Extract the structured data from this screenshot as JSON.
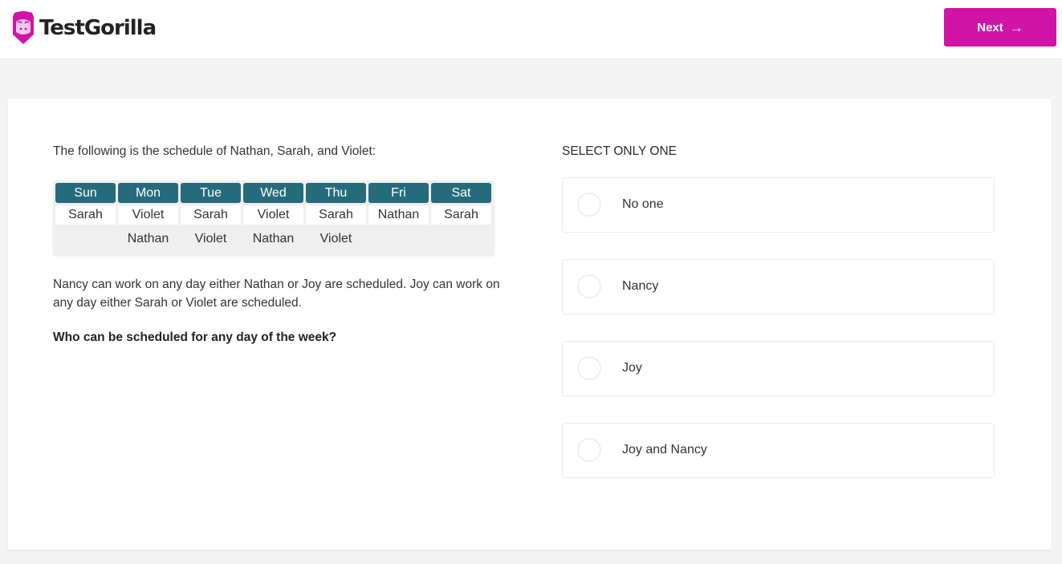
{
  "header": {
    "brand_name": "TestGorilla",
    "brand_color": "#d113a8",
    "logo_icon": "gorilla-logo-icon",
    "next_label": "Next",
    "next_icon": "arrow-right-icon"
  },
  "question": {
    "intro": "The following is the schedule of Nathan, Sarah, and Violet:",
    "schedule": {
      "header_color": "#266b7c",
      "days": [
        "Sun",
        "Mon",
        "Tue",
        "Wed",
        "Thu",
        "Fri",
        "Sat"
      ],
      "row1": [
        "Sarah",
        "Violet",
        "Sarah",
        "Violet",
        "Sarah",
        "Nathan",
        "Sarah"
      ],
      "row2": [
        "",
        "Nathan",
        "Violet",
        "Nathan",
        "Violet",
        "",
        ""
      ]
    },
    "description": "Nancy can work on any day either Nathan or Joy are scheduled. Joy can work on any day either Sarah or Violet are scheduled.",
    "prompt": "Who can be scheduled for any day of the week?"
  },
  "answers": {
    "instruction": "SELECT ONLY ONE",
    "options": [
      {
        "label": "No one",
        "selected": false
      },
      {
        "label": "Nancy",
        "selected": false
      },
      {
        "label": "Joy",
        "selected": false
      },
      {
        "label": "Joy and Nancy",
        "selected": false
      }
    ]
  }
}
